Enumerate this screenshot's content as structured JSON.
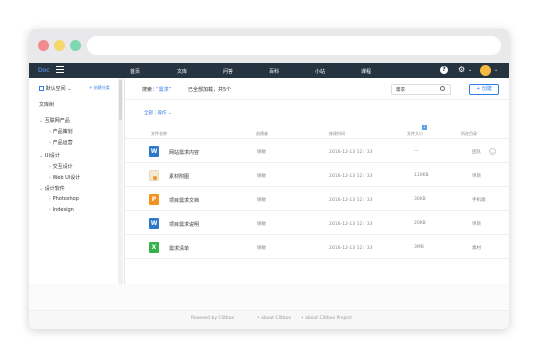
{
  "nav": {
    "logo": "Doc",
    "items": [
      "首页",
      "文库",
      "问答",
      "百科",
      "小站",
      "课程"
    ],
    "help_icon": "?",
    "gear_icon": "⚙",
    "caret": "⌄"
  },
  "sidebar": {
    "space_label": "默认空间",
    "space_caret": "⌄",
    "create_space": "+ 创建分类",
    "root": "文库树",
    "tree": [
      {
        "label": "互联网产品",
        "level": 0,
        "expanded": true
      },
      {
        "label": "产品策划",
        "level": 1
      },
      {
        "label": "产品运营",
        "level": 1
      },
      {
        "label": "UI设计",
        "level": 0,
        "expanded": true
      },
      {
        "label": "交互设计",
        "level": 1
      },
      {
        "label": "Web UI设计",
        "level": 1
      },
      {
        "label": "设计软件",
        "level": 0,
        "expanded": true
      },
      {
        "label": "Photoshop",
        "level": 1
      },
      {
        "label": "Indesign",
        "level": 1
      }
    ]
  },
  "main": {
    "search_prefix": "搜索：",
    "search_term": "“需求”",
    "search_result": "已全部加载，共5个",
    "search_value": "需求",
    "new_button": "+ 创建",
    "crumbs": {
      "all": "全部",
      "action": "操作"
    },
    "columns": {
      "name": "文件名称",
      "creator": "创建者",
      "modified": "修改时间",
      "size": "文件大小",
      "location": "所在目录",
      "sort_badge": "↓"
    },
    "rows": [
      {
        "icon": "W",
        "icon_color": "#2b79c7",
        "name": "网站需求内容",
        "creator": "微敏",
        "modified": "2016-12-13 12：33",
        "size": "—",
        "location": "团队"
      },
      {
        "icon": "img",
        "icon_color": "#f4e9d3",
        "name": "素材附图",
        "creator": "微敏",
        "modified": "2016-12-13 12：33",
        "size": "110KB",
        "location": "项目"
      },
      {
        "icon": "P",
        "icon_color": "#f29423",
        "name": "项目需求文档",
        "creator": "微敏",
        "modified": "2016-12-13 12：33",
        "size": "30KB",
        "location": "手机端"
      },
      {
        "icon": "W",
        "icon_color": "#2b79c7",
        "name": "项目需求说明",
        "creator": "微敏",
        "modified": "2016-12-13 12：33",
        "size": "20KB",
        "location": "项目"
      },
      {
        "icon": "X",
        "icon_color": "#36b34a",
        "name": "需求清单",
        "creator": "微敏",
        "modified": "2016-12-13 12：33",
        "size": "3MB",
        "location": "素材"
      }
    ]
  },
  "footer": {
    "powered": "Powered by Clitbox",
    "about1": "• about Clitbox",
    "about2": "• about Clitbox  Project"
  }
}
